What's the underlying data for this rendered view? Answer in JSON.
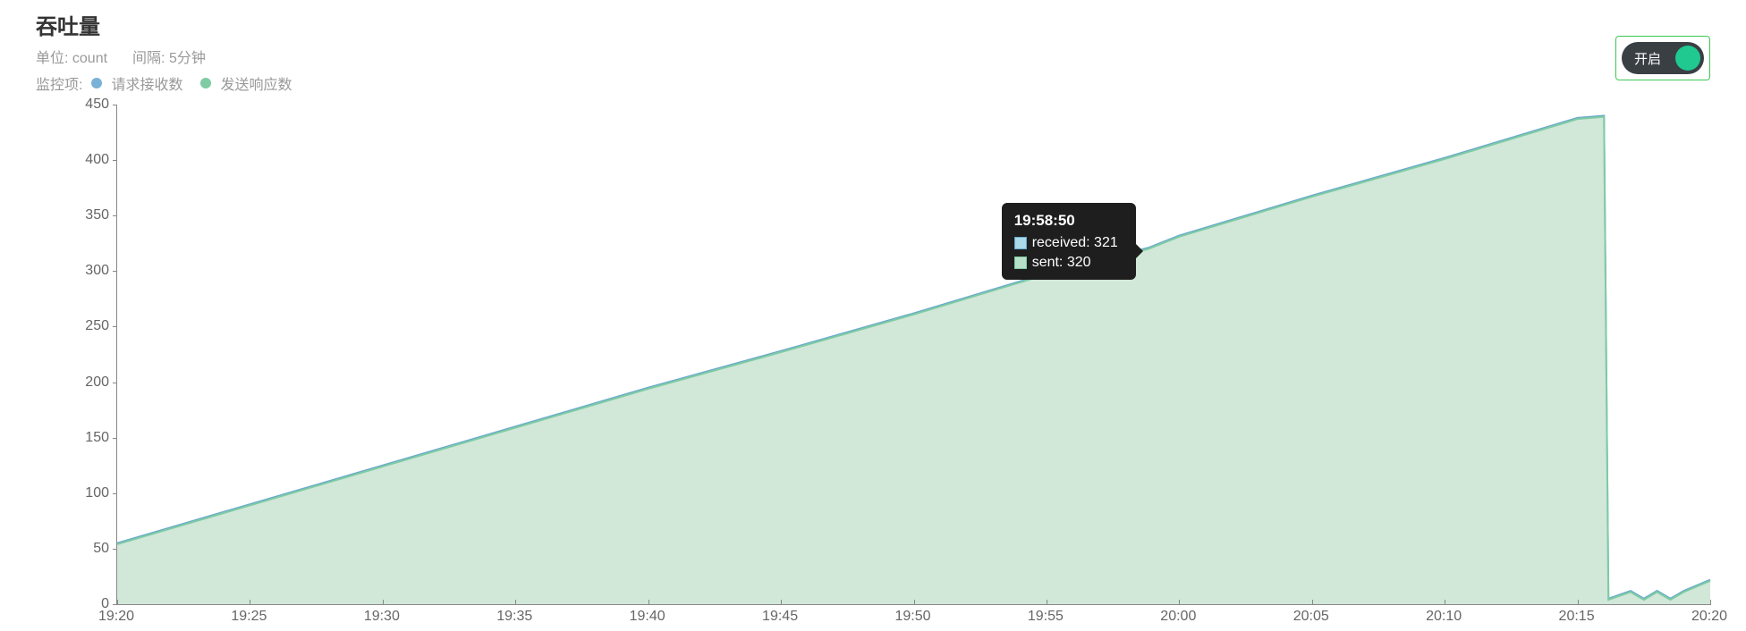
{
  "title": "吞吐量",
  "meta": {
    "unit_label": "单位: count",
    "interval_label": "间隔: 5分钟",
    "monitor_label": "监控项:",
    "legend": [
      {
        "name": "请求接收数",
        "color": "#7ab1d6"
      },
      {
        "name": "发送响应数",
        "color": "#7ecba4"
      }
    ]
  },
  "toggle": {
    "label": "开启",
    "on": true,
    "border_color": "#3cc954",
    "track_color": "#3a3f44",
    "knob_color": "#1fc990"
  },
  "tooltip": {
    "time": "19:58:50",
    "items": [
      {
        "label": "received",
        "value": 321,
        "color": "#a9d9ea",
        "border": "#6aa9cc"
      },
      {
        "label": "sent",
        "value": 320,
        "color": "#b7e0c8",
        "border": "#7ecba4"
      }
    ]
  },
  "chart_data": {
    "type": "area",
    "title": "吞吐量",
    "xlabel": "",
    "ylabel": "",
    "ylim": [
      0,
      450
    ],
    "y_ticks": [
      0,
      50,
      100,
      150,
      200,
      250,
      300,
      350,
      400,
      450
    ],
    "x_ticks": [
      "19:20",
      "19:25",
      "19:30",
      "19:35",
      "19:40",
      "19:45",
      "19:50",
      "19:55",
      "20:00",
      "20:05",
      "20:10",
      "20:15",
      "20:20"
    ],
    "x_min": "19:20",
    "x_max": "20:20",
    "series": [
      {
        "name": "received",
        "legend_zh": "请求接收数",
        "color_line": "#6aa9cc",
        "color_fill": "#c6e0d4",
        "points": [
          {
            "x": "19:20",
            "y": 55
          },
          {
            "x": "19:25",
            "y": 90
          },
          {
            "x": "19:30",
            "y": 125
          },
          {
            "x": "19:35",
            "y": 160
          },
          {
            "x": "19:40",
            "y": 195
          },
          {
            "x": "19:45",
            "y": 228
          },
          {
            "x": "19:50",
            "y": 262
          },
          {
            "x": "19:55",
            "y": 298
          },
          {
            "x": "19:58:50",
            "y": 321
          },
          {
            "x": "20:00",
            "y": 332
          },
          {
            "x": "20:05",
            "y": 368
          },
          {
            "x": "20:10",
            "y": 402
          },
          {
            "x": "20:15",
            "y": 438
          },
          {
            "x": "20:16",
            "y": 440
          },
          {
            "x": "20:16:10",
            "y": 5
          },
          {
            "x": "20:17",
            "y": 12
          },
          {
            "x": "20:17:30",
            "y": 5
          },
          {
            "x": "20:18",
            "y": 12
          },
          {
            "x": "20:18:30",
            "y": 5
          },
          {
            "x": "20:19",
            "y": 12
          },
          {
            "x": "20:20",
            "y": 22
          }
        ]
      },
      {
        "name": "sent",
        "legend_zh": "发送响应数",
        "color_line": "#7ecba4",
        "color_fill": "#d4ead9",
        "points": [
          {
            "x": "19:20",
            "y": 54
          },
          {
            "x": "19:25",
            "y": 89
          },
          {
            "x": "19:30",
            "y": 124
          },
          {
            "x": "19:35",
            "y": 159
          },
          {
            "x": "19:40",
            "y": 194
          },
          {
            "x": "19:45",
            "y": 227
          },
          {
            "x": "19:50",
            "y": 261
          },
          {
            "x": "19:55",
            "y": 297
          },
          {
            "x": "19:58:50",
            "y": 320
          },
          {
            "x": "20:00",
            "y": 331
          },
          {
            "x": "20:05",
            "y": 367
          },
          {
            "x": "20:10",
            "y": 401
          },
          {
            "x": "20:15",
            "y": 437
          },
          {
            "x": "20:16",
            "y": 439
          },
          {
            "x": "20:16:10",
            "y": 4
          },
          {
            "x": "20:17",
            "y": 11
          },
          {
            "x": "20:17:30",
            "y": 4
          },
          {
            "x": "20:18",
            "y": 11
          },
          {
            "x": "20:18:30",
            "y": 4
          },
          {
            "x": "20:19",
            "y": 11
          },
          {
            "x": "20:20",
            "y": 21
          }
        ]
      }
    ]
  }
}
